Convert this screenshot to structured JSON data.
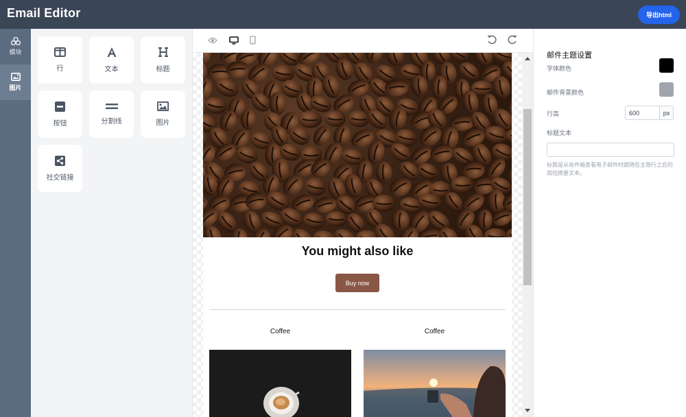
{
  "app": {
    "title": "Email Editor",
    "export_label": "导出html"
  },
  "rail": {
    "items": [
      {
        "label": "模块",
        "icon": "blocks-icon"
      },
      {
        "label": "图片",
        "icon": "images-icon"
      }
    ]
  },
  "blocks": [
    {
      "label": "行",
      "icon": "columns-icon"
    },
    {
      "label": "文本",
      "icon": "text-icon"
    },
    {
      "label": "标题",
      "icon": "heading-icon"
    },
    {
      "label": "按钮",
      "icon": "button-icon"
    },
    {
      "label": "分割线",
      "icon": "divider-icon"
    },
    {
      "label": "图片",
      "icon": "image-icon"
    },
    {
      "label": "社交链接",
      "icon": "share-icon"
    }
  ],
  "toolbar": {
    "icons": [
      "eye-icon",
      "desktop-icon",
      "mobile-icon",
      "undo-icon",
      "redo-icon"
    ]
  },
  "email": {
    "headline": "You might also like",
    "button_label": "Buy now",
    "columns": [
      {
        "label": "Coffee"
      },
      {
        "label": "Coffee"
      }
    ],
    "button_color": "#8a5747"
  },
  "settings": {
    "title": "邮件主题设置",
    "font_color_label": "字体颜色",
    "font_color": "#000000",
    "bg_color_label": "邮件背景颜色",
    "bg_color": "#a0a5ae",
    "line_height_label": "行高",
    "line_height_value": "600",
    "line_height_unit": "px",
    "preheader_label": "标题文本",
    "preheader_value": "",
    "help_text": "标题是从收件箱查看电子邮件时跟随在主题行之后的简短摘要文本。"
  },
  "colors": {
    "header": "#3a4556",
    "accent": "#2563eb",
    "rail": "#5b6b80"
  }
}
